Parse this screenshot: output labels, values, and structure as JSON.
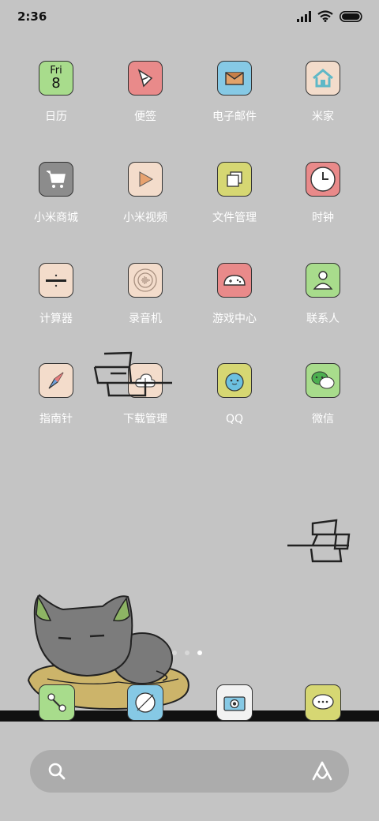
{
  "status_bar": {
    "time": "2:36"
  },
  "calendar": {
    "weekday": "Fri",
    "day": "8"
  },
  "apps": [
    {
      "label": "日历",
      "icon": "calendar-icon",
      "color": "#a8dc8c"
    },
    {
      "label": "便签",
      "icon": "notes-icon",
      "color": "#e98a8a"
    },
    {
      "label": "电子邮件",
      "icon": "mail-icon",
      "color": "#86c9e5"
    },
    {
      "label": "米家",
      "icon": "home-icon",
      "color": "#f3dccb"
    },
    {
      "label": "小米商城",
      "icon": "cart-icon",
      "color": "#8c8c8c"
    },
    {
      "label": "小米视频",
      "icon": "play-icon",
      "color": "#f3dccb"
    },
    {
      "label": "文件管理",
      "icon": "files-icon",
      "color": "#d6d773"
    },
    {
      "label": "时钟",
      "icon": "clock-icon",
      "color": "#e98a8a"
    },
    {
      "label": "计算器",
      "icon": "calculator-icon",
      "color": "#f3dccb"
    },
    {
      "label": "录音机",
      "icon": "recorder-icon",
      "color": "#f3dccb"
    },
    {
      "label": "游戏中心",
      "icon": "gamepad-icon",
      "color": "#e98a8a"
    },
    {
      "label": "联系人",
      "icon": "contacts-icon",
      "color": "#a8dc8c"
    },
    {
      "label": "指南针",
      "icon": "compass-icon",
      "color": "#f3dccb"
    },
    {
      "label": "下载管理",
      "icon": "download-icon",
      "color": "#f3dccb"
    },
    {
      "label": "QQ",
      "icon": "qq-icon",
      "color": "#d6d773"
    },
    {
      "label": "微信",
      "icon": "wechat-icon",
      "color": "#a8dc8c"
    }
  ],
  "dock": [
    {
      "icon": "phone-icon",
      "color": "#a8dc8c"
    },
    {
      "icon": "browser-icon",
      "color": "#86c9e5"
    },
    {
      "icon": "camera-icon",
      "color": "#f2f2f2"
    },
    {
      "icon": "messages-icon",
      "color": "#d6d773"
    }
  ],
  "page_indicator": {
    "pages": 3,
    "current": 3
  },
  "search": {
    "placeholder": ""
  }
}
